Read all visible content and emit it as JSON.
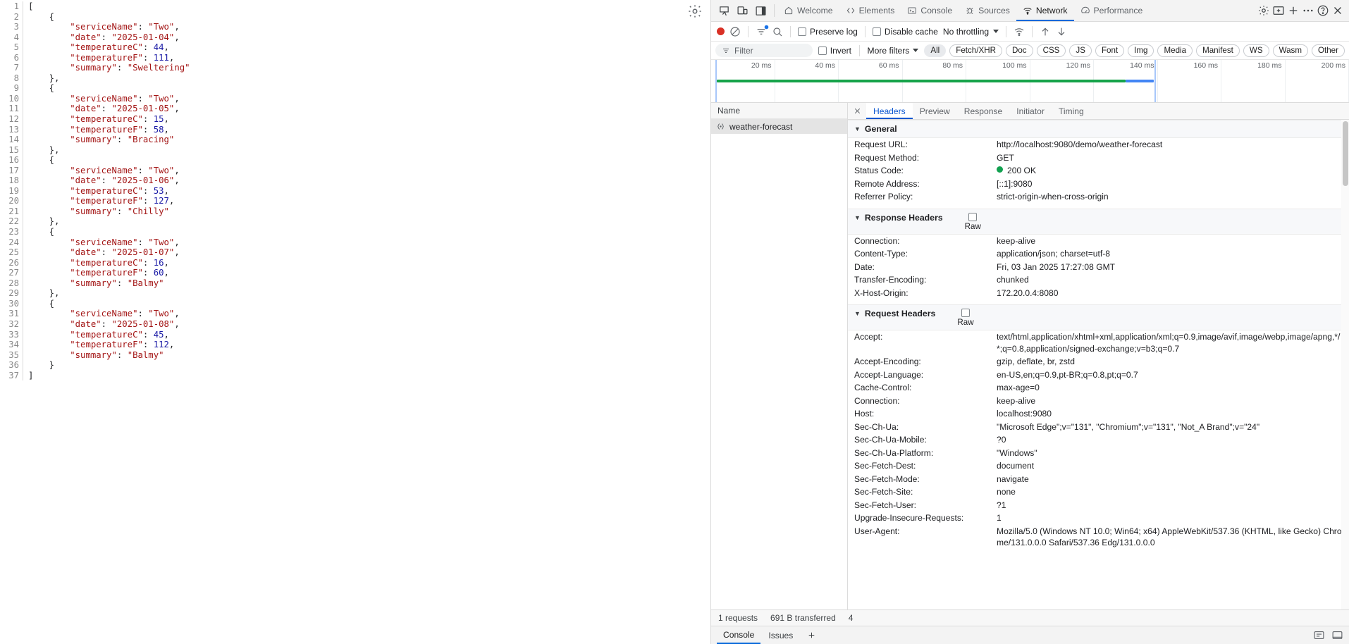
{
  "page": {
    "gear_icon": "gear-icon",
    "json_lines": [
      {
        "n": "1",
        "html": "<span class='p'>[</span>"
      },
      {
        "n": "2",
        "html": "    <span class='p'>{</span>"
      },
      {
        "n": "3",
        "html": "        <span class='k'>\"serviceName\"</span><span class='p'>: </span><span class='s'>\"Two\"</span><span class='p'>,</span>"
      },
      {
        "n": "4",
        "html": "        <span class='k'>\"date\"</span><span class='p'>: </span><span class='s'>\"2025-01-04\"</span><span class='p'>,</span>"
      },
      {
        "n": "5",
        "html": "        <span class='k'>\"temperatureC\"</span><span class='p'>: </span><span class='n'>44</span><span class='p'>,</span>"
      },
      {
        "n": "6",
        "html": "        <span class='k'>\"temperatureF\"</span><span class='p'>: </span><span class='n'>111</span><span class='p'>,</span>"
      },
      {
        "n": "7",
        "html": "        <span class='k'>\"summary\"</span><span class='p'>: </span><span class='s'>\"Sweltering\"</span>"
      },
      {
        "n": "8",
        "html": "    <span class='p'>},</span>"
      },
      {
        "n": "9",
        "html": "    <span class='p'>{</span>"
      },
      {
        "n": "10",
        "html": "        <span class='k'>\"serviceName\"</span><span class='p'>: </span><span class='s'>\"Two\"</span><span class='p'>,</span>"
      },
      {
        "n": "11",
        "html": "        <span class='k'>\"date\"</span><span class='p'>: </span><span class='s'>\"2025-01-05\"</span><span class='p'>,</span>"
      },
      {
        "n": "12",
        "html": "        <span class='k'>\"temperatureC\"</span><span class='p'>: </span><span class='n'>15</span><span class='p'>,</span>"
      },
      {
        "n": "13",
        "html": "        <span class='k'>\"temperatureF\"</span><span class='p'>: </span><span class='n'>58</span><span class='p'>,</span>"
      },
      {
        "n": "14",
        "html": "        <span class='k'>\"summary\"</span><span class='p'>: </span><span class='s'>\"Bracing\"</span>"
      },
      {
        "n": "15",
        "html": "    <span class='p'>},</span>"
      },
      {
        "n": "16",
        "html": "    <span class='p'>{</span>"
      },
      {
        "n": "17",
        "html": "        <span class='k'>\"serviceName\"</span><span class='p'>: </span><span class='s'>\"Two\"</span><span class='p'>,</span>"
      },
      {
        "n": "18",
        "html": "        <span class='k'>\"date\"</span><span class='p'>: </span><span class='s'>\"2025-01-06\"</span><span class='p'>,</span>"
      },
      {
        "n": "19",
        "html": "        <span class='k'>\"temperatureC\"</span><span class='p'>: </span><span class='n'>53</span><span class='p'>,</span>"
      },
      {
        "n": "20",
        "html": "        <span class='k'>\"temperatureF\"</span><span class='p'>: </span><span class='n'>127</span><span class='p'>,</span>"
      },
      {
        "n": "21",
        "html": "        <span class='k'>\"summary\"</span><span class='p'>: </span><span class='s'>\"Chilly\"</span>"
      },
      {
        "n": "22",
        "html": "    <span class='p'>},</span>"
      },
      {
        "n": "23",
        "html": "    <span class='p'>{</span>"
      },
      {
        "n": "24",
        "html": "        <span class='k'>\"serviceName\"</span><span class='p'>: </span><span class='s'>\"Two\"</span><span class='p'>,</span>"
      },
      {
        "n": "25",
        "html": "        <span class='k'>\"date\"</span><span class='p'>: </span><span class='s'>\"2025-01-07\"</span><span class='p'>,</span>"
      },
      {
        "n": "26",
        "html": "        <span class='k'>\"temperatureC\"</span><span class='p'>: </span><span class='n'>16</span><span class='p'>,</span>"
      },
      {
        "n": "27",
        "html": "        <span class='k'>\"temperatureF\"</span><span class='p'>: </span><span class='n'>60</span><span class='p'>,</span>"
      },
      {
        "n": "28",
        "html": "        <span class='k'>\"summary\"</span><span class='p'>: </span><span class='s'>\"Balmy\"</span>"
      },
      {
        "n": "29",
        "html": "    <span class='p'>},</span>"
      },
      {
        "n": "30",
        "html": "    <span class='p'>{</span>"
      },
      {
        "n": "31",
        "html": "        <span class='k'>\"serviceName\"</span><span class='p'>: </span><span class='s'>\"Two\"</span><span class='p'>,</span>"
      },
      {
        "n": "32",
        "html": "        <span class='k'>\"date\"</span><span class='p'>: </span><span class='s'>\"2025-01-08\"</span><span class='p'>,</span>"
      },
      {
        "n": "33",
        "html": "        <span class='k'>\"temperatureC\"</span><span class='p'>: </span><span class='n'>45</span><span class='p'>,</span>"
      },
      {
        "n": "34",
        "html": "        <span class='k'>\"temperatureF\"</span><span class='p'>: </span><span class='n'>112</span><span class='p'>,</span>"
      },
      {
        "n": "35",
        "html": "        <span class='k'>\"summary\"</span><span class='p'>: </span><span class='s'>\"Balmy\"</span>"
      },
      {
        "n": "36",
        "html": "    <span class='p'>}</span>"
      },
      {
        "n": "37",
        "html": "<span class='p'>]</span>"
      }
    ],
    "forecast_records": [
      {
        "serviceName": "Two",
        "date": "2025-01-04",
        "temperatureC": 44,
        "temperatureF": 111,
        "summary": "Sweltering"
      },
      {
        "serviceName": "Two",
        "date": "2025-01-05",
        "temperatureC": 15,
        "temperatureF": 58,
        "summary": "Bracing"
      },
      {
        "serviceName": "Two",
        "date": "2025-01-06",
        "temperatureC": 53,
        "temperatureF": 127,
        "summary": "Chilly"
      },
      {
        "serviceName": "Two",
        "date": "2025-01-07",
        "temperatureC": 16,
        "temperatureF": 60,
        "summary": "Balmy"
      },
      {
        "serviceName": "Two",
        "date": "2025-01-08",
        "temperatureC": 45,
        "temperatureF": 112,
        "summary": "Balmy"
      }
    ]
  },
  "devtools": {
    "tabs": [
      {
        "label": "Welcome",
        "icon": "home-icon",
        "active": false
      },
      {
        "label": "Elements",
        "icon": "code-brackets-icon",
        "active": false
      },
      {
        "label": "Console",
        "icon": "terminal-icon",
        "active": false
      },
      {
        "label": "Sources",
        "icon": "bug-icon",
        "active": false
      },
      {
        "label": "Network",
        "icon": "wifi-icon",
        "active": true
      },
      {
        "label": "Performance",
        "icon": "gauge-icon",
        "active": false
      }
    ],
    "tabbar_icons": [
      "settings-gear-icon",
      "add-panel-icon",
      "more-tabs-icon",
      "help-icon",
      "close-devtools-icon"
    ],
    "dock_icons": [
      "inspect-element-icon",
      "device-toolbar-icon",
      "dock-side-icon"
    ],
    "controls": {
      "record_label": "record-button",
      "clear_label": "clear-button",
      "filter_toggle": "filter-icon",
      "search_label": "search-icon",
      "preserve_log": "Preserve log",
      "disable_cache": "Disable cache",
      "throttling": "No throttling",
      "import_label": "import-har-icon",
      "export_label": "export-har-icon",
      "wifi_label": "network-conditions-icon"
    },
    "filters": {
      "placeholder": "Filter",
      "invert": "Invert",
      "more_filters": "More filters",
      "types": [
        "All",
        "Fetch/XHR",
        "Doc",
        "CSS",
        "JS",
        "Font",
        "Img",
        "Media",
        "Manifest",
        "WS",
        "Wasm",
        "Other"
      ],
      "active_type": "All"
    },
    "overview": {
      "ticks": [
        "20 ms",
        "40 ms",
        "60 ms",
        "80 ms",
        "100 ms",
        "120 ms",
        "140 ms",
        "160 ms",
        "180 ms",
        "200 ms"
      ],
      "bar_color": "#16a34a",
      "bar2_color": "#4285f4"
    },
    "request_list": {
      "column_header": "Name",
      "rows": [
        {
          "name": "weather-forecast",
          "icon": "json-doc-icon",
          "selected": true
        }
      ]
    },
    "detail": {
      "tabs": [
        "Headers",
        "Preview",
        "Response",
        "Initiator",
        "Timing"
      ],
      "active_tab": "Headers",
      "close_icon": "close-icon",
      "sections": [
        {
          "title": "General",
          "raw": false,
          "rows": [
            {
              "key": "Request URL:",
              "value": "http://localhost:9080/demo/weather-forecast"
            },
            {
              "key": "Request Method:",
              "value": "GET"
            },
            {
              "key": "Status Code:",
              "value": "200 OK",
              "status": true
            },
            {
              "key": "Remote Address:",
              "value": "[::1]:9080"
            },
            {
              "key": "Referrer Policy:",
              "value": "strict-origin-when-cross-origin"
            }
          ]
        },
        {
          "title": "Response Headers",
          "raw": true,
          "raw_label": "Raw",
          "rows": [
            {
              "key": "Connection:",
              "value": "keep-alive"
            },
            {
              "key": "Content-Type:",
              "value": "application/json; charset=utf-8"
            },
            {
              "key": "Date:",
              "value": "Fri, 03 Jan 2025 17:27:08 GMT"
            },
            {
              "key": "Transfer-Encoding:",
              "value": "chunked"
            },
            {
              "key": "X-Host-Origin:",
              "value": "172.20.0.4:8080"
            }
          ]
        },
        {
          "title": "Request Headers",
          "raw": true,
          "raw_label": "Raw",
          "rows": [
            {
              "key": "Accept:",
              "value": "text/html,application/xhtml+xml,application/xml;q=0.9,image/avif,image/webp,image/apng,*/*;q=0.8,application/signed-exchange;v=b3;q=0.7"
            },
            {
              "key": "Accept-Encoding:",
              "value": "gzip, deflate, br, zstd"
            },
            {
              "key": "Accept-Language:",
              "value": "en-US,en;q=0.9,pt-BR;q=0.8,pt;q=0.7"
            },
            {
              "key": "Cache-Control:",
              "value": "max-age=0"
            },
            {
              "key": "Connection:",
              "value": "keep-alive"
            },
            {
              "key": "Host:",
              "value": "localhost:9080"
            },
            {
              "key": "Sec-Ch-Ua:",
              "value": "\"Microsoft Edge\";v=\"131\", \"Chromium\";v=\"131\", \"Not_A Brand\";v=\"24\""
            },
            {
              "key": "Sec-Ch-Ua-Mobile:",
              "value": "?0"
            },
            {
              "key": "Sec-Ch-Ua-Platform:",
              "value": "\"Windows\""
            },
            {
              "key": "Sec-Fetch-Dest:",
              "value": "document"
            },
            {
              "key": "Sec-Fetch-Mode:",
              "value": "navigate"
            },
            {
              "key": "Sec-Fetch-Site:",
              "value": "none"
            },
            {
              "key": "Sec-Fetch-User:",
              "value": "?1"
            },
            {
              "key": "Upgrade-Insecure-Requests:",
              "value": "1"
            },
            {
              "key": "User-Agent:",
              "value": "Mozilla/5.0 (Windows NT 10.0; Win64; x64) AppleWebKit/537.36 (KHTML, like Gecko) Chrome/131.0.0.0 Safari/537.36 Edg/131.0.0.0"
            }
          ]
        }
      ]
    },
    "status_bar": {
      "requests": "1 requests",
      "transferred": "691 B transferred",
      "resources": "4"
    },
    "drawer": {
      "tabs": [
        "Console",
        "Issues"
      ],
      "active_tab": "Console",
      "add_label": "add-drawer-tab-icon",
      "right_icons": [
        "settings-icon",
        "close-drawer-icon"
      ]
    },
    "colors": {
      "accent": "#0b57d0",
      "record": "#d93025",
      "status_ok": "#12a150",
      "timeline_green": "#16a34a",
      "timeline_blue": "#4285f4"
    }
  }
}
